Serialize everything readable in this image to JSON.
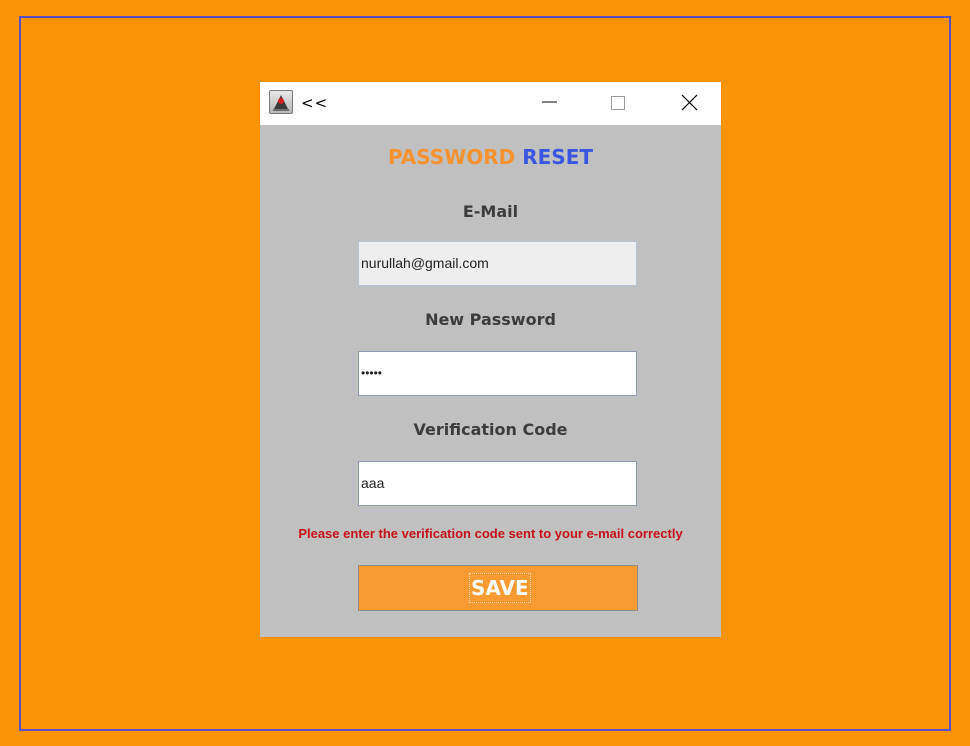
{
  "window": {
    "title": "<<",
    "icons": {
      "app": "java-app-icon",
      "minimize": "minimize-icon",
      "maximize": "maximize-icon",
      "close": "close-icon"
    }
  },
  "form": {
    "heading_part1": "PASSWORD",
    "heading_part2": "RESET",
    "email_label": "E-Mail",
    "email_value": "nurullah@gmail.com",
    "password_label": "New Password",
    "password_value": "•••••",
    "code_label": "Verification Code",
    "code_value": "aaa",
    "error_message": "Please enter the verification code  sent to your e-mail correctly",
    "save_label": "SAVE"
  },
  "colors": {
    "background": "#fb9307",
    "frame_border": "#5a4fc0",
    "heading_accent_1": "#f5922f",
    "heading_accent_2": "#3a55e0",
    "error": "#c8101a",
    "save_button": "#fb9a30"
  }
}
